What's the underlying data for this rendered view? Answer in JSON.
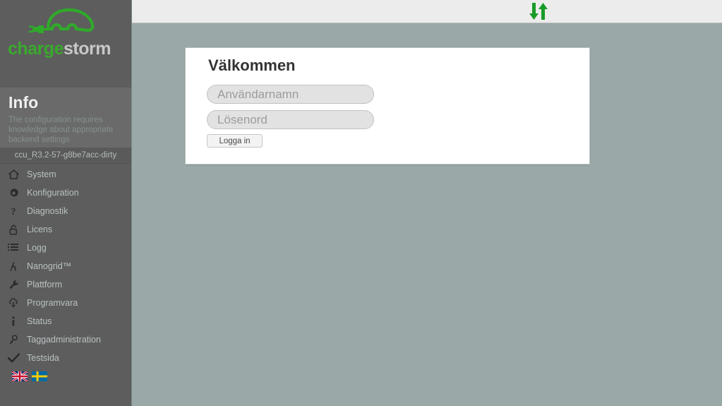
{
  "brand": {
    "logo_charge": "charge",
    "logo_storm": "storm",
    "logo_icon": "electric-car-plug-icon",
    "logo_color_green": "#3aa82d",
    "logo_color_gray": "#c8c8c8"
  },
  "sidebar": {
    "info": {
      "title": "Info",
      "text": "The configuration requires knowledge about appropriate backend settings"
    },
    "version": "ccu_R3.2-57-g8be7acc-dirty",
    "items": [
      {
        "label": "System",
        "icon": "home-icon"
      },
      {
        "label": "Konfiguration",
        "icon": "gear-icon"
      },
      {
        "label": "Diagnostik",
        "icon": "question-mark-icon"
      },
      {
        "label": "Licens",
        "icon": "unlocked-padlock-icon"
      },
      {
        "label": "Logg",
        "icon": "list-icon"
      },
      {
        "label": "Nanogrid™",
        "icon": "nanogrid-icon"
      },
      {
        "label": "Plattform",
        "icon": "wrench-icon"
      },
      {
        "label": "Programvara",
        "icon": "software-cloud-icon"
      },
      {
        "label": "Status",
        "icon": "info-i-icon"
      },
      {
        "label": "Taggadministration",
        "icon": "key-icon"
      },
      {
        "label": "Testsida",
        "icon": "checkmark-icon"
      }
    ],
    "languages": [
      {
        "name": "english",
        "icon": "uk-flag-icon"
      },
      {
        "name": "swedish",
        "icon": "sweden-flag-icon"
      }
    ]
  },
  "topbar": {
    "sync_icon": "data-transfer-arrows-icon",
    "sync_color": "#179c28"
  },
  "login": {
    "title": "Välkommen",
    "username": {
      "value": "",
      "placeholder": "Användarnamn"
    },
    "password": {
      "value": "",
      "placeholder": "Lösenord"
    },
    "submit_label": "Logga in"
  }
}
